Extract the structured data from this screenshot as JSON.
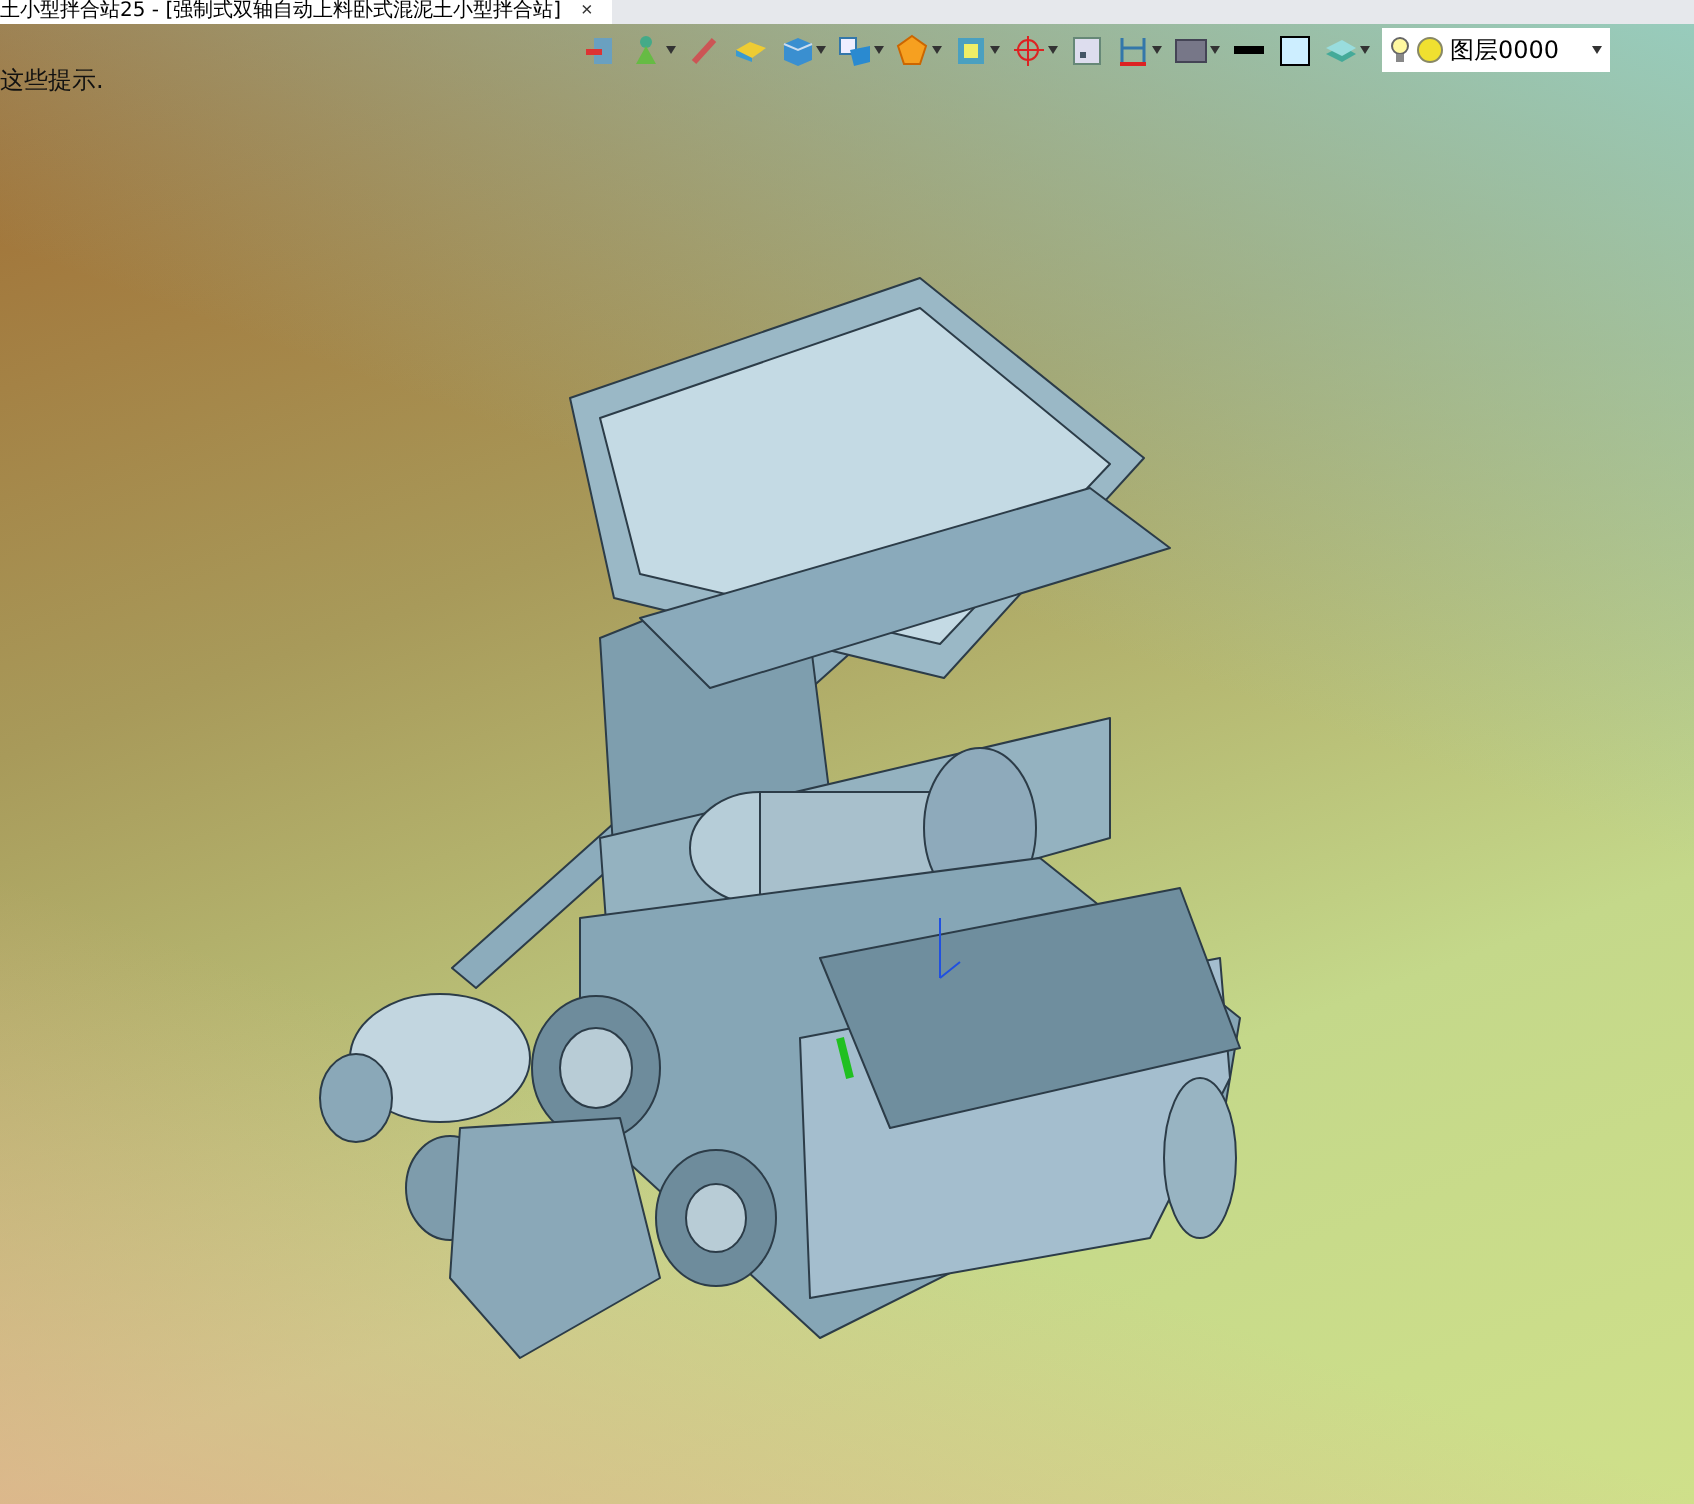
{
  "tab": {
    "title": "土小型拌合站25 - [强制式双轴自动上料卧式混泥土小型拌合站]",
    "close": "×"
  },
  "hint": "这些提示.",
  "layer": {
    "name": "图层0000",
    "on": true
  }
}
